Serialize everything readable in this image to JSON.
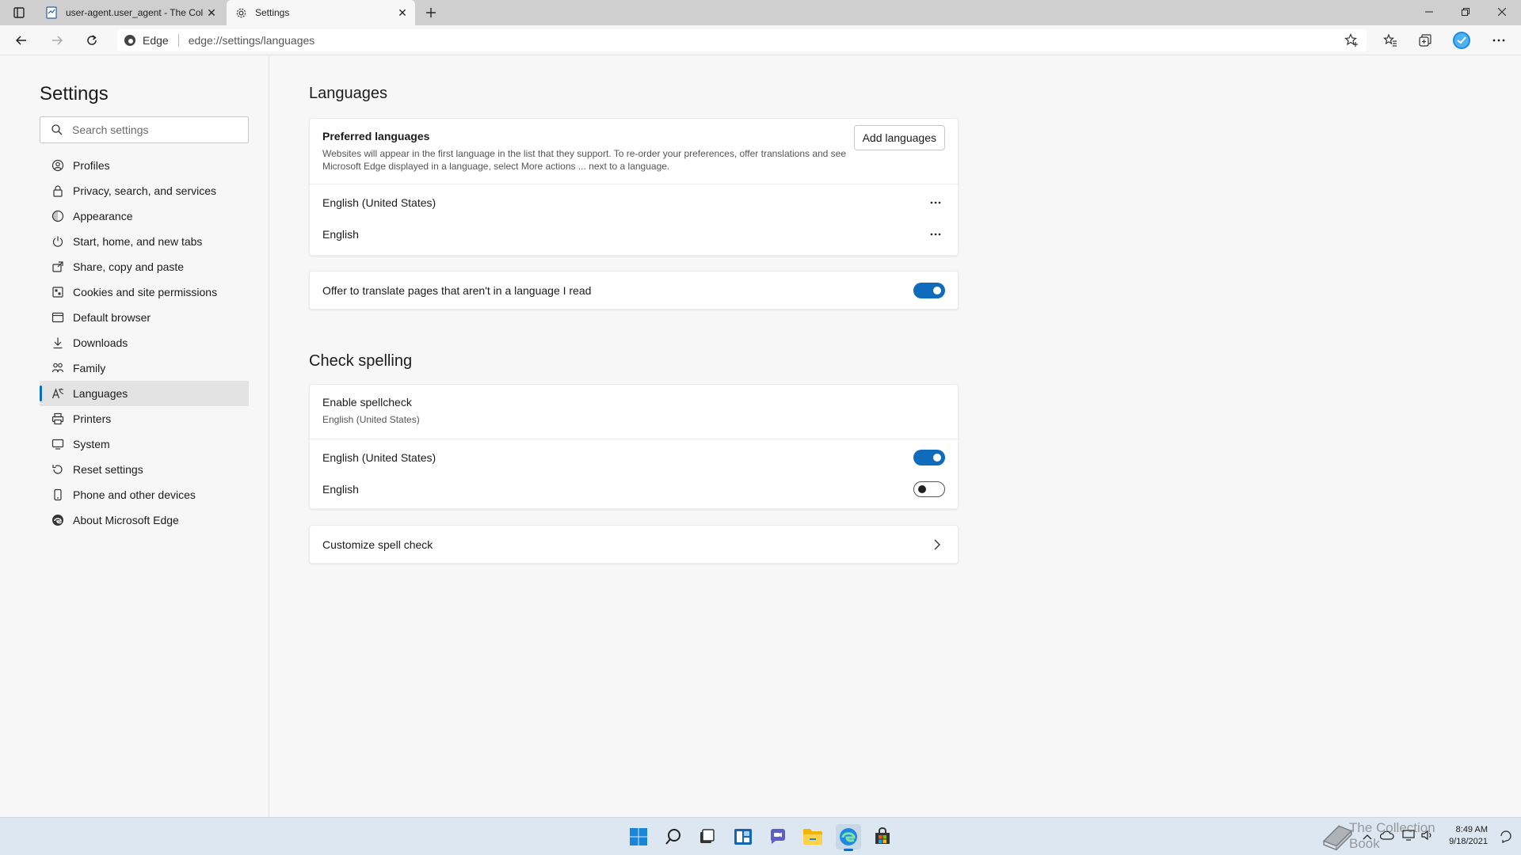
{
  "browser": {
    "tabs": [
      {
        "title": "user-agent.user_agent - The Coll",
        "active": false
      },
      {
        "title": "Settings",
        "active": true
      }
    ],
    "address": {
      "label": "Edge",
      "url": "edge://settings/languages"
    }
  },
  "sidebar": {
    "title": "Settings",
    "search_placeholder": "Search settings",
    "items": [
      {
        "label": "Profiles",
        "icon": "profile-icon"
      },
      {
        "label": "Privacy, search, and services",
        "icon": "lock-icon"
      },
      {
        "label": "Appearance",
        "icon": "appearance-icon"
      },
      {
        "label": "Start, home, and new tabs",
        "icon": "power-icon"
      },
      {
        "label": "Share, copy and paste",
        "icon": "share-icon"
      },
      {
        "label": "Cookies and site permissions",
        "icon": "cookies-icon"
      },
      {
        "label": "Default browser",
        "icon": "browser-icon"
      },
      {
        "label": "Downloads",
        "icon": "download-icon"
      },
      {
        "label": "Family",
        "icon": "family-icon"
      },
      {
        "label": "Languages",
        "icon": "languages-icon",
        "selected": true
      },
      {
        "label": "Printers",
        "icon": "printer-icon"
      },
      {
        "label": "System",
        "icon": "system-icon"
      },
      {
        "label": "Reset settings",
        "icon": "reset-icon"
      },
      {
        "label": "Phone and other devices",
        "icon": "phone-icon"
      },
      {
        "label": "About Microsoft Edge",
        "icon": "edge-icon"
      }
    ]
  },
  "languages": {
    "title": "Languages",
    "preferred_title": "Preferred languages",
    "preferred_desc": "Websites will appear in the first language in the list that they support. To re-order your preferences, offer translations and see Microsoft Edge displayed in a language, select More actions ... next to a language.",
    "add_button": "Add languages",
    "list": [
      "English (United States)",
      "English"
    ],
    "translate_label": "Offer to translate pages that aren't in a language I read",
    "translate_on": true
  },
  "spelling": {
    "title": "Check spelling",
    "enable_label": "Enable spellcheck",
    "enable_sub": "English (United States)",
    "langs": [
      {
        "label": "English (United States)",
        "on": true
      },
      {
        "label": "English",
        "on": false
      }
    ],
    "customize_label": "Customize spell check"
  },
  "taskbar": {
    "time": "8:49 AM",
    "date": "9/18/2021",
    "watermark": "The Collection Book"
  },
  "colors": {
    "accent": "#0f6cbd",
    "taskbar": "#dce7f1",
    "sidebar_selected": "#e3e3e3"
  }
}
